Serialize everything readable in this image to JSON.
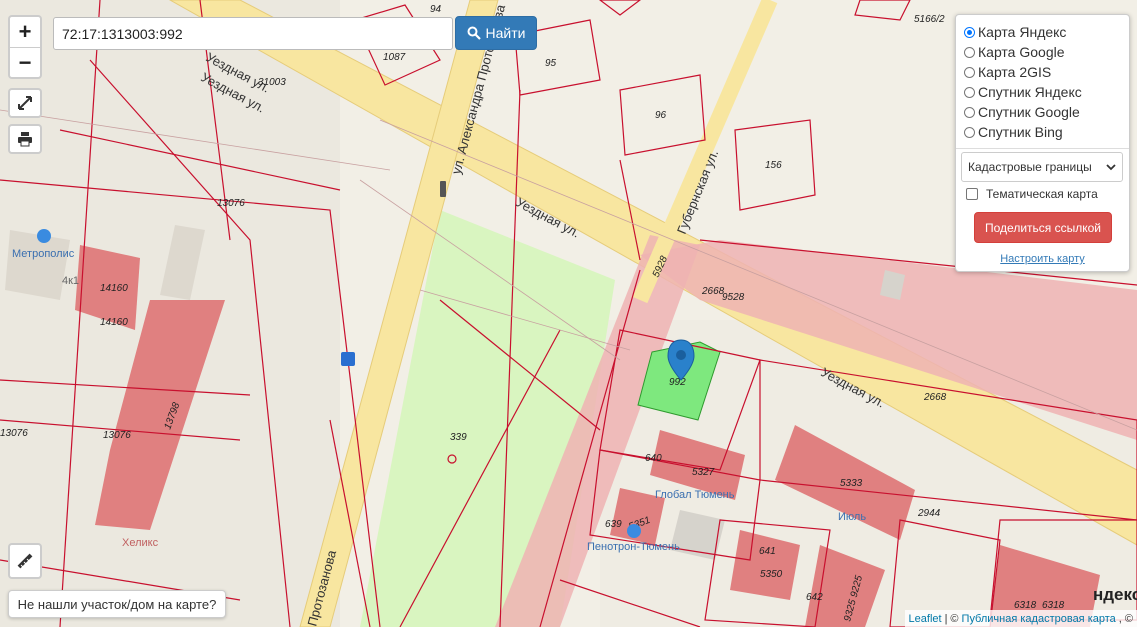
{
  "map": {
    "street_labels": [
      "Уездная ул.",
      "Уездная ул.",
      "Уездная ул.",
      "Уездная ул.",
      "ул. Александра Протозанова",
      "Губернская ул.",
      "Протозанова"
    ],
    "parcel_labels": [
      "94",
      "5166/2",
      "1087",
      "95",
      "31003",
      "96",
      "156",
      "13076",
      "14160",
      "14160",
      "5928",
      "2668",
      "9528",
      "992",
      "2668",
      "13798",
      "13076",
      "13076",
      "339",
      "640",
      "5327",
      "5333",
      "639",
      "5351",
      "2944",
      "641",
      "5350",
      "642",
      "9325 9225",
      "6318",
      "6318"
    ],
    "poi_labels": [
      "Метрополис",
      "4к1",
      "Глобал Тюмень",
      "Пенотрон-Тюмень",
      "Хеликс",
      "Июль"
    ],
    "yandex_logo": "ндекс",
    "selected_parcel": "992",
    "colors": {
      "parcel_line": "#c8102e",
      "building": "#e08080",
      "selected": "#7ee87e",
      "park": "#d9f5c0",
      "road": "#f8e6a0",
      "highlight_band": "#eeb3b3",
      "marker": "#2a81cb"
    }
  },
  "controls": {
    "zoom_in": "+",
    "zoom_out": "−",
    "fullscreen_icon": "fullscreen-icon",
    "print_icon": "printer-icon",
    "ruler_icon": "ruler-icon"
  },
  "search": {
    "value": "72:17:1313003:992",
    "button": "Найти"
  },
  "panel": {
    "layers": [
      {
        "label": "Карта Яндекс",
        "checked": true
      },
      {
        "label": "Карта Google",
        "checked": false
      },
      {
        "label": "Карта 2GIS",
        "checked": false
      },
      {
        "label": "Спутник Яндекс",
        "checked": false
      },
      {
        "label": "Спутник Google",
        "checked": false
      },
      {
        "label": "Спутник Bing",
        "checked": false
      }
    ],
    "overlay_select": "Кадастровые границы",
    "thematic": "Тематическая карта",
    "share_button": "Поделиться ссылкой",
    "configure_link": "Настроить карту"
  },
  "not_found": "Не нашли участок/дом на карте?",
  "attribution": {
    "leaflet": "Leaflet",
    "sep1": "|",
    "copyright": "©",
    "pkk": "Публичная кадастровая карта",
    "tail": ", ©"
  }
}
